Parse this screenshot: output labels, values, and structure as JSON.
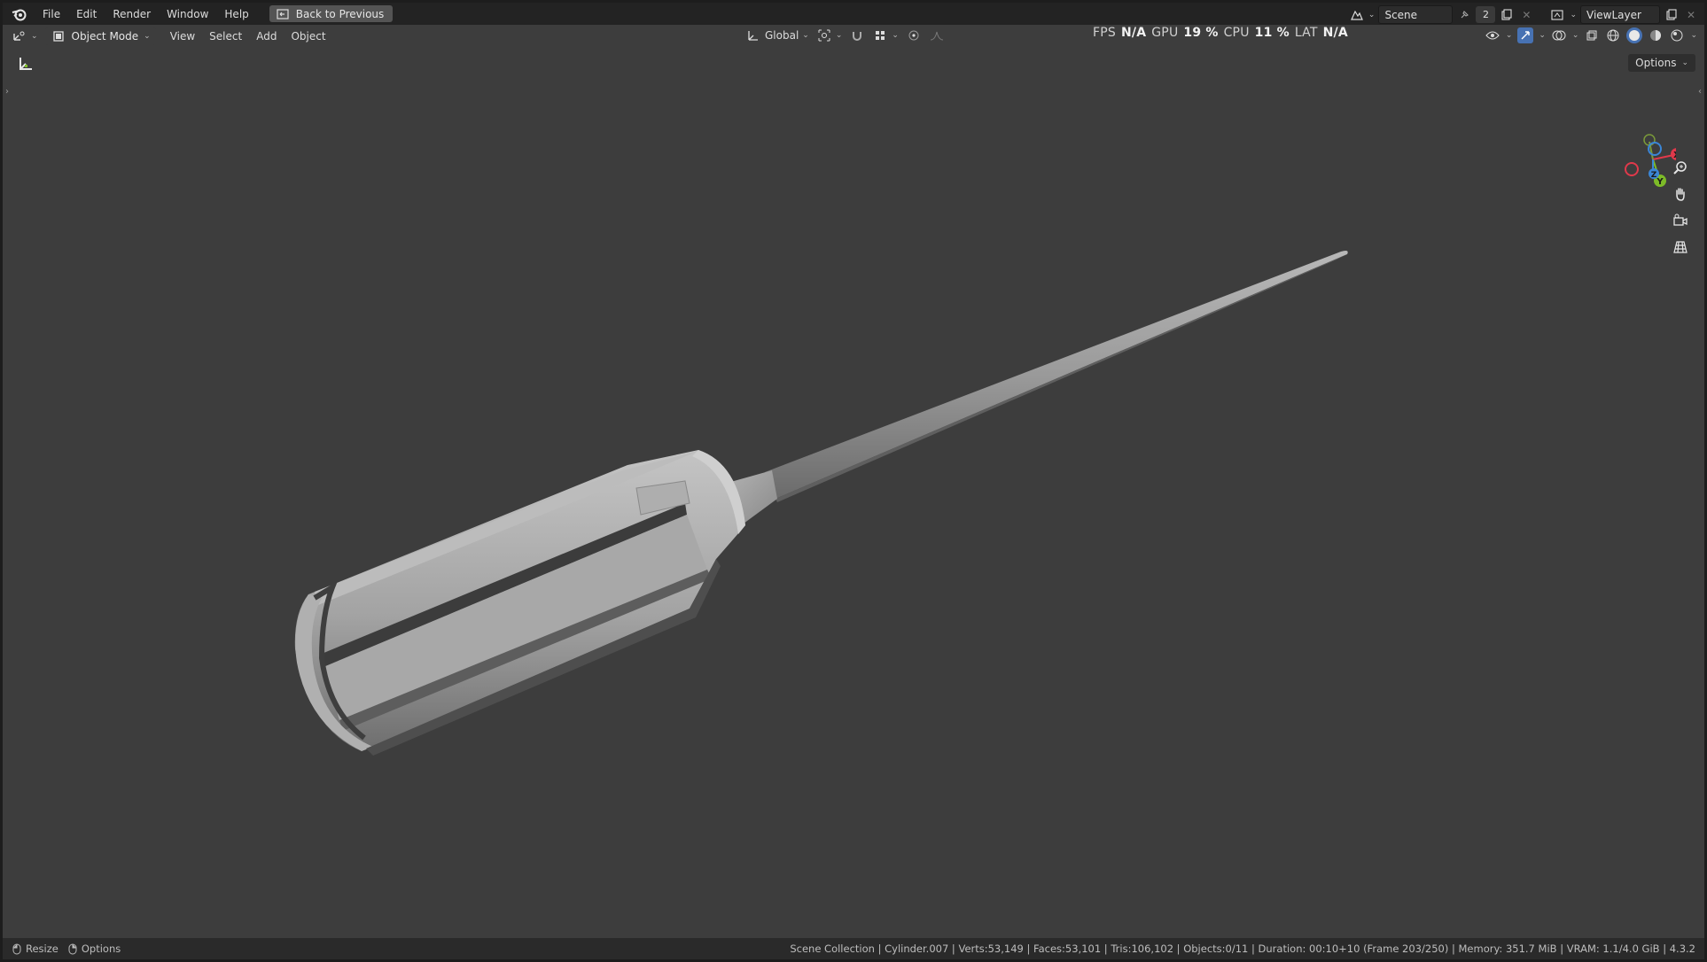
{
  "menu": {
    "items": [
      "File",
      "Edit",
      "Render",
      "Window",
      "Help"
    ],
    "back_button": "Back to Previous"
  },
  "topbar_right": {
    "scene_label": "Scene",
    "scene_users": "2",
    "view_layer_label": "ViewLayer"
  },
  "header": {
    "mode_label": "Object Mode",
    "menus": [
      "View",
      "Select",
      "Add",
      "Object"
    ],
    "transform_orientation": "Global"
  },
  "perf_stats": {
    "fps_label": "FPS",
    "fps_value": "N/A",
    "gpu_label": "GPU",
    "gpu_value": "19 %",
    "cpu_label": "CPU",
    "cpu_value": "11 %",
    "lat_label": "LAT",
    "lat_value": "N/A"
  },
  "viewport": {
    "options_label": "Options",
    "gizmo_axes": [
      "X",
      "Y",
      "Z"
    ],
    "colors": {
      "x": "#e0394b",
      "y": "#7dbb28",
      "z": "#3b86d6",
      "background": "#3d3d3d"
    }
  },
  "statusbar": {
    "left_items": [
      "Resize",
      "Options"
    ],
    "info": "Scene Collection | Cylinder.007 | Verts:53,149 | Faces:53,101 | Tris:106,102 | Objects:0/11 | Duration: 00:10+10 (Frame 203/250) | Memory: 351.7 MiB | VRAM: 1.1/4.0 GiB | 4.3.2"
  }
}
